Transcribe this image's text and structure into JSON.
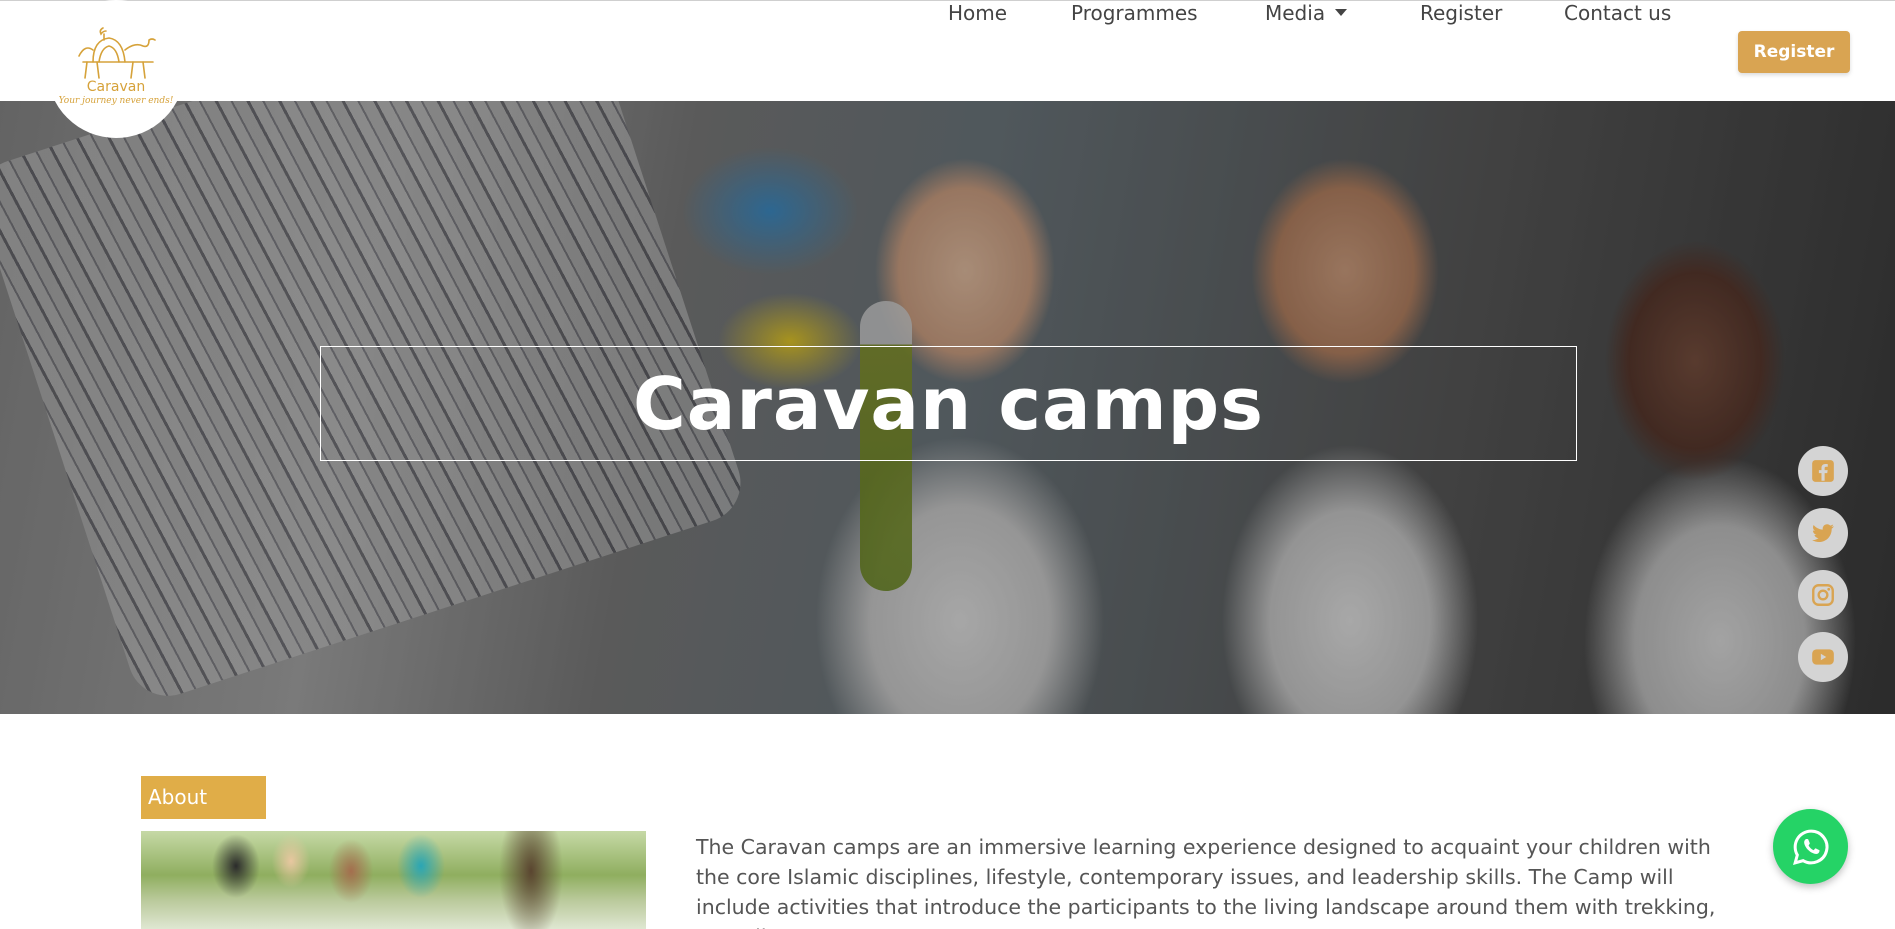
{
  "brand": {
    "name": "Caravan",
    "tagline": "Your journey never ends!",
    "accent_color": "#d9a452"
  },
  "nav": {
    "items": [
      {
        "label": "Home"
      },
      {
        "label": "Programmes"
      },
      {
        "label": "Media",
        "has_dropdown": true
      },
      {
        "label": "Register"
      },
      {
        "label": "Contact us"
      }
    ],
    "cta_label": "Register"
  },
  "hero": {
    "title": "Caravan camps"
  },
  "social": {
    "icons": [
      "facebook-icon",
      "twitter-icon",
      "instagram-icon",
      "youtube-icon"
    ]
  },
  "about": {
    "tab_label": "About",
    "text": "The Caravan camps are an immersive learning experience designed to acquaint your children with the core Islamic disciplines, lifestyle, contemporary issues, and leadership skills. The Camp will include activities that introduce the participants to the living landscape around them with trekking, as well as to"
  },
  "whatsapp": {
    "icon": "whatsapp-icon",
    "color": "#25d366"
  }
}
